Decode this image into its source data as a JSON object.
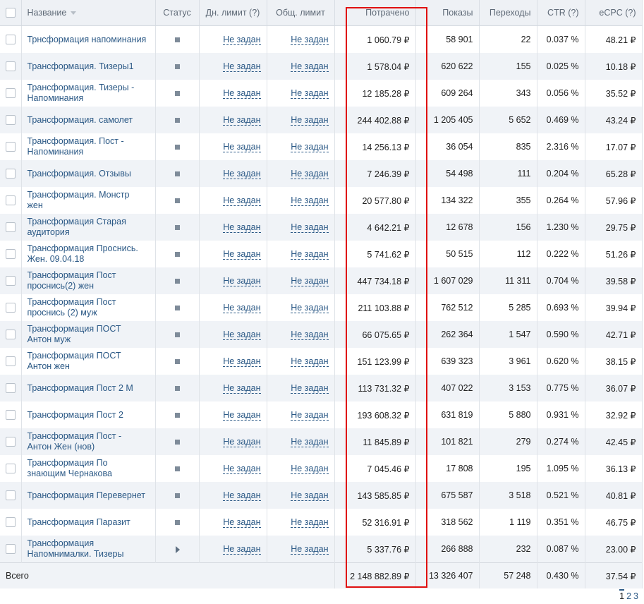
{
  "header": {
    "name": "Название",
    "status": "Статус",
    "daily_limit": "Дн. лимит (?)",
    "total_limit": "Общ. лимит",
    "spent": "Потрачено",
    "impressions": "Показы",
    "clicks": "Переходы",
    "ctr": "CTR (?)",
    "ecpc": "eCPC (?)"
  },
  "rows": [
    {
      "name": "Трнсформация напоминания",
      "status": "stopped",
      "daily_limit": "Не задан",
      "total_limit": "Не задан",
      "spent": "1 060.79 ₽",
      "impressions": "58 901",
      "clicks": "22",
      "ctr": "0.037 %",
      "ecpc": "48.21 ₽"
    },
    {
      "name": "Трансформация. Тизеры1",
      "status": "stopped",
      "daily_limit": "Не задан",
      "total_limit": "Не задан",
      "spent": "1 578.04 ₽",
      "impressions": "620 622",
      "clicks": "155",
      "ctr": "0.025 %",
      "ecpc": "10.18 ₽"
    },
    {
      "name": "Трансформация. Тизеры - Напоминания",
      "status": "stopped",
      "daily_limit": "Не задан",
      "total_limit": "Не задан",
      "spent": "12 185.28 ₽",
      "impressions": "609 264",
      "clicks": "343",
      "ctr": "0.056 %",
      "ecpc": "35.52 ₽"
    },
    {
      "name": "Трансформация. самолет",
      "status": "stopped",
      "daily_limit": "Не задан",
      "total_limit": "Не задан",
      "spent": "244 402.88 ₽",
      "impressions": "1 205 405",
      "clicks": "5 652",
      "ctr": "0.469 %",
      "ecpc": "43.24 ₽"
    },
    {
      "name": "Трансформация. Пост - Напоминания",
      "status": "stopped",
      "daily_limit": "Не задан",
      "total_limit": "Не задан",
      "spent": "14 256.13 ₽",
      "impressions": "36 054",
      "clicks": "835",
      "ctr": "2.316 %",
      "ecpc": "17.07 ₽"
    },
    {
      "name": "Трансформация. Отзывы",
      "status": "stopped",
      "daily_limit": "Не задан",
      "total_limit": "Не задан",
      "spent": "7 246.39 ₽",
      "impressions": "54 498",
      "clicks": "111",
      "ctr": "0.204 %",
      "ecpc": "65.28 ₽"
    },
    {
      "name": "Трансформация. Монстр жен",
      "status": "stopped",
      "daily_limit": "Не задан",
      "total_limit": "Не задан",
      "spent": "20 577.80 ₽",
      "impressions": "134 322",
      "clicks": "355",
      "ctr": "0.264 %",
      "ecpc": "57.96 ₽"
    },
    {
      "name": "Трансформация Старая аудитория",
      "status": "stopped",
      "daily_limit": "Не задан",
      "total_limit": "Не задан",
      "spent": "4 642.21 ₽",
      "impressions": "12 678",
      "clicks": "156",
      "ctr": "1.230 %",
      "ecpc": "29.75 ₽"
    },
    {
      "name": "Трансформация Проснись. Жен. 09.04.18",
      "status": "stopped",
      "daily_limit": "Не задан",
      "total_limit": "Не задан",
      "spent": "5 741.62 ₽",
      "impressions": "50 515",
      "clicks": "112",
      "ctr": "0.222 %",
      "ecpc": "51.26 ₽"
    },
    {
      "name": "Трансформация Пост проснись(2) жен",
      "status": "stopped",
      "daily_limit": "Не задан",
      "total_limit": "Не задан",
      "spent": "447 734.18 ₽",
      "impressions": "1 607 029",
      "clicks": "11 311",
      "ctr": "0.704 %",
      "ecpc": "39.58 ₽"
    },
    {
      "name": "Трансформация Пост проснись (2) муж",
      "status": "stopped",
      "daily_limit": "Не задан",
      "total_limit": "Не задан",
      "spent": "211 103.88 ₽",
      "impressions": "762 512",
      "clicks": "5 285",
      "ctr": "0.693 %",
      "ecpc": "39.94 ₽"
    },
    {
      "name": "Трансформация ПОСТ Антон муж",
      "status": "stopped",
      "daily_limit": "Не задан",
      "total_limit": "Не задан",
      "spent": "66 075.65 ₽",
      "impressions": "262 364",
      "clicks": "1 547",
      "ctr": "0.590 %",
      "ecpc": "42.71 ₽"
    },
    {
      "name": "Трансформация ПОСТ Антон жен",
      "status": "stopped",
      "daily_limit": "Не задан",
      "total_limit": "Не задан",
      "spent": "151 123.99 ₽",
      "impressions": "639 323",
      "clicks": "3 961",
      "ctr": "0.620 %",
      "ecpc": "38.15 ₽"
    },
    {
      "name": "Трансформация Пост 2 М",
      "status": "stopped",
      "daily_limit": "Не задан",
      "total_limit": "Не задан",
      "spent": "113 731.32 ₽",
      "impressions": "407 022",
      "clicks": "3 153",
      "ctr": "0.775 %",
      "ecpc": "36.07 ₽"
    },
    {
      "name": "Трансформация Пост 2",
      "status": "stopped",
      "daily_limit": "Не задан",
      "total_limit": "Не задан",
      "spent": "193 608.32 ₽",
      "impressions": "631 819",
      "clicks": "5 880",
      "ctr": "0.931 %",
      "ecpc": "32.92 ₽"
    },
    {
      "name": "Трансформация Пост - Антон Жен (нов)",
      "status": "stopped",
      "daily_limit": "Не задан",
      "total_limit": "Не задан",
      "spent": "11 845.89 ₽",
      "impressions": "101 821",
      "clicks": "279",
      "ctr": "0.274 %",
      "ecpc": "42.45 ₽"
    },
    {
      "name": "Трансформация По знающим Чернакова",
      "status": "stopped",
      "daily_limit": "Не задан",
      "total_limit": "Не задан",
      "spent": "7 045.46 ₽",
      "impressions": "17 808",
      "clicks": "195",
      "ctr": "1.095 %",
      "ecpc": "36.13 ₽"
    },
    {
      "name": "Трансформация Перевернет",
      "status": "stopped",
      "daily_limit": "Не задан",
      "total_limit": "Не задан",
      "spent": "143 585.85 ₽",
      "impressions": "675 587",
      "clicks": "3 518",
      "ctr": "0.521 %",
      "ecpc": "40.81 ₽"
    },
    {
      "name": "Трансформация Паразит",
      "status": "stopped",
      "daily_limit": "Не задан",
      "total_limit": "Не задан",
      "spent": "52 316.91 ₽",
      "impressions": "318 562",
      "clicks": "1 119",
      "ctr": "0.351 %",
      "ecpc": "46.75 ₽"
    },
    {
      "name": "Трансформация Напомнималки. Тизеры",
      "status": "paused",
      "daily_limit": "Не задан",
      "total_limit": "Не задан",
      "spent": "5 337.76 ₽",
      "impressions": "266 888",
      "clicks": "232",
      "ctr": "0.087 %",
      "ecpc": "23.00 ₽"
    }
  ],
  "totals": {
    "label": "Всего",
    "spent": "2 148 882.89 ₽",
    "impressions": "13 326 407",
    "clicks": "57 248",
    "ctr": "0.430 %",
    "ecpc": "37.54 ₽"
  },
  "pagination": {
    "pages": [
      "1",
      "2",
      "3"
    ],
    "current": "1"
  },
  "colors": {
    "link": "#2a5885",
    "header_bg": "#eef1f5",
    "stripe": "#f0f3f7",
    "highlight": "#e01010"
  },
  "icons": {
    "status_stopped": "stop-square-icon",
    "status_paused": "play-triangle-icon",
    "sort": "sort-down-icon"
  }
}
